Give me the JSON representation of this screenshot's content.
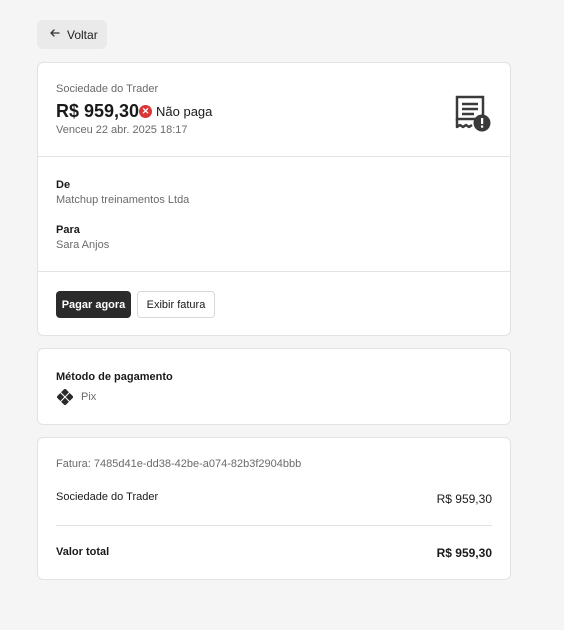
{
  "nav": {
    "back_label": "Voltar"
  },
  "invoice": {
    "merchant": "Sociedade do Trader",
    "amount": "R$ 959,30",
    "status": "Não paga",
    "due": "Venceu 22 abr. 2025 18:17",
    "from_label": "De",
    "from_value": "Matchup treinamentos Ltda",
    "to_label": "Para",
    "to_value": "Sara Anjos",
    "pay_label": "Pagar agora",
    "view_label": "Exibir fatura"
  },
  "payment": {
    "title": "Método de pagamento",
    "method": "Pix"
  },
  "summary": {
    "invoice_id": "Fatura: 7485d41e-dd38-42be-a074-82b3f2904bbb",
    "line_item": "Sociedade do Trader",
    "line_amount": "R$ 959,30",
    "total_label": "Valor total",
    "total_amount": "R$ 959,30"
  },
  "colors": {
    "status_error": "#d93636",
    "primary_button": "#2b2b2b"
  },
  "icons": {
    "back": "arrow-left-icon",
    "receipt": "receipt-alert-icon",
    "pix": "pix-icon",
    "status": "close-circle-icon"
  }
}
